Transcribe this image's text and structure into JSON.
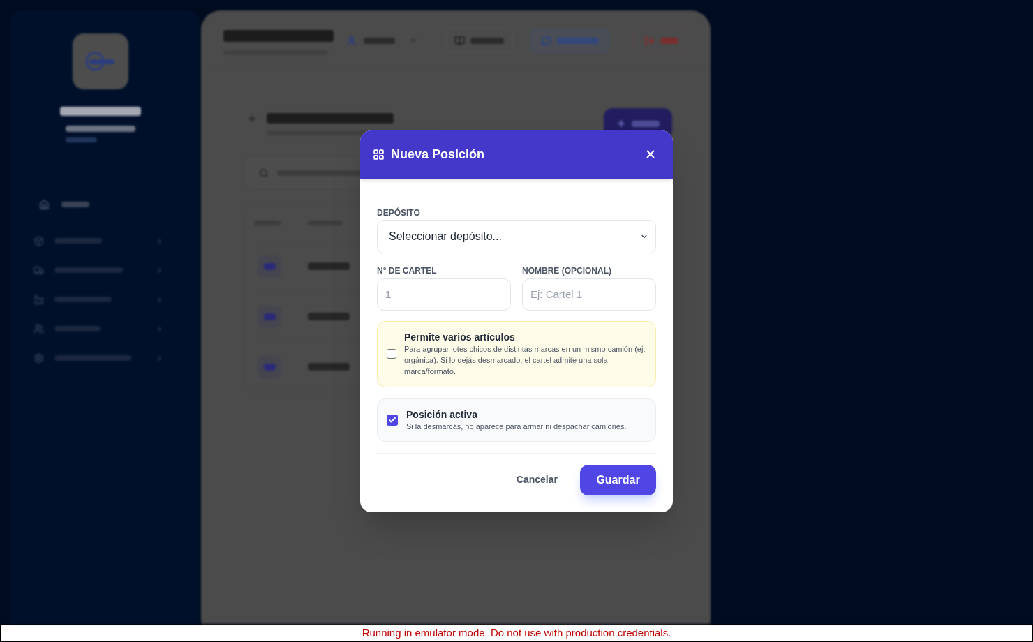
{
  "modal": {
    "title": "Nueva Posición",
    "deposit_select": {
      "label": "DEPÓSITO",
      "value": "Seleccionar depósito..."
    },
    "inputs": [
      {
        "kind": "number",
        "label": "N° DE CARTEL",
        "placeholder": "1"
      },
      {
        "kind": "text",
        "label": "NOMBRE (OPCIONAL)",
        "placeholder": "Ej: Cartel 1"
      }
    ],
    "options": [
      {
        "kind": "highlight",
        "title": "Permite varios artículos",
        "description": "Para agrupar lotes chicos de distintas marcas en un mismo camión (ej: orgánica). Si lo dejás desmarcado, el cartel admite una sola marca/formato.",
        "checked": false
      },
      {
        "kind": "plain",
        "title": "Posición activa",
        "description": "Si la desmarcás, no aparece para armar ni despachar camiones.",
        "checked": true
      }
    ],
    "buttons": [
      {
        "kind": "secondary",
        "label": "Cancelar"
      },
      {
        "kind": "primary",
        "label": "Guardar"
      }
    ]
  },
  "banner": {
    "text": "Running in emulator mode. Do not use with production credentials."
  }
}
